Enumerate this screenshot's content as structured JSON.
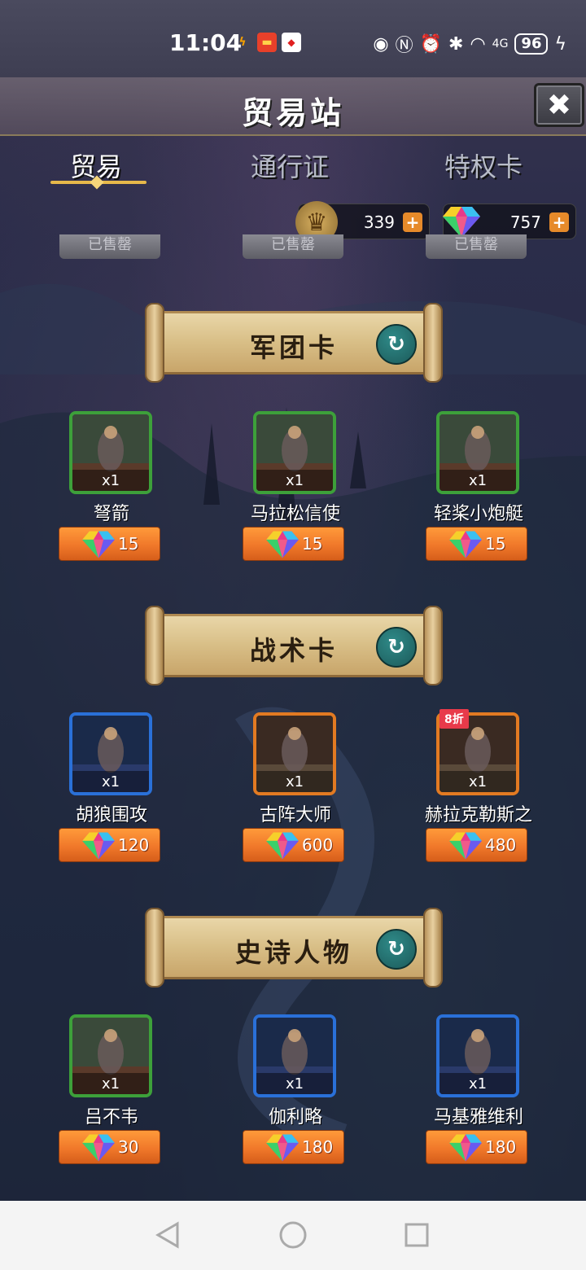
{
  "status_bar": {
    "time": "11:04",
    "battery": "96",
    "notif_icons": [
      "lightning-app-icon",
      "red-envelope-icon",
      "red-app-icon"
    ],
    "signal_label": "4G"
  },
  "header": {
    "title": "贸易站",
    "close_label": "✖"
  },
  "tabs": [
    {
      "label": "贸易",
      "active": true
    },
    {
      "label": "通行证",
      "active": false
    },
    {
      "label": "特权卡",
      "active": false
    }
  ],
  "currencies": [
    {
      "icon": "crest-icon",
      "value": "339"
    },
    {
      "icon": "gem-icon",
      "value": "757"
    }
  ],
  "sold_label": "已售罄",
  "sections": [
    {
      "title": "军团卡",
      "items": [
        {
          "name": "弩箭",
          "qty": "x1",
          "price": "15",
          "frame": "green",
          "discount": ""
        },
        {
          "name": "马拉松信使",
          "qty": "x1",
          "price": "15",
          "frame": "green",
          "discount": ""
        },
        {
          "name": "轻桨小炮艇",
          "qty": "x1",
          "price": "15",
          "frame": "green",
          "discount": ""
        }
      ]
    },
    {
      "title": "战术卡",
      "items": [
        {
          "name": "胡狼围攻",
          "qty": "x1",
          "price": "120",
          "frame": "blue",
          "discount": ""
        },
        {
          "name": "古阵大师",
          "qty": "x1",
          "price": "600",
          "frame": "orange",
          "discount": ""
        },
        {
          "name": "赫拉克勒斯之",
          "qty": "x1",
          "price": "480",
          "frame": "orange",
          "discount": "8折"
        }
      ]
    },
    {
      "title": "史诗人物",
      "items": [
        {
          "name": "吕不韦",
          "qty": "x1",
          "price": "30",
          "frame": "green",
          "discount": ""
        },
        {
          "name": "伽利略",
          "qty": "x1",
          "price": "180",
          "frame": "blue",
          "discount": ""
        },
        {
          "name": "马基雅维利",
          "qty": "x1",
          "price": "180",
          "frame": "blue",
          "discount": ""
        }
      ]
    }
  ],
  "colors": {
    "accent": "#e6b84a",
    "price_button": "#f0782a",
    "refresh": "#1c5a5a"
  }
}
